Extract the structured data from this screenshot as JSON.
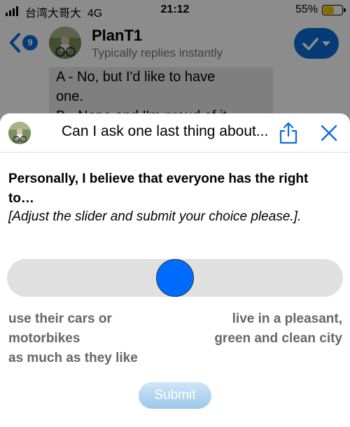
{
  "status_bar": {
    "carrier": "台湾大哥大",
    "network": "4G",
    "time": "21:12",
    "battery_percent": "55%",
    "battery_level": 0.55
  },
  "chat_header": {
    "back_count": "9",
    "name": "PlanT1",
    "subtitle": "Typically replies instantly",
    "icons": [
      "chevron-left-icon",
      "checkmark-icon",
      "caret-down-icon"
    ]
  },
  "background_message": {
    "line1": "A - No, but I'd like to have",
    "line2": "one.",
    "line3": "B - Nope and I'm proud of it"
  },
  "sheet": {
    "title": "Can I ask one last thing about...",
    "icons": [
      "share-icon",
      "close-icon"
    ],
    "accent": "#0b6cd8"
  },
  "survey": {
    "question": "Personally, I believe that everyone has the right to…",
    "instruction": "[Adjust the slider and submit your choice please.].",
    "slider_value": 0.5,
    "left_label_line1": "use their cars or",
    "left_label_line2": "motorbikes",
    "left_label_line3": "as much as they like",
    "right_label_line1": "live in a pleasant,",
    "right_label_line2": "green and clean city",
    "submit_label": "Submit",
    "thumb_color": "#006cff"
  }
}
